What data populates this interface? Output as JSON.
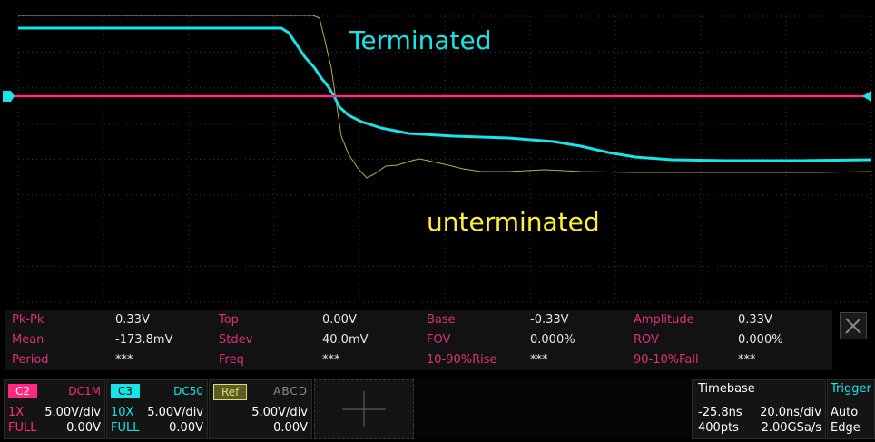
{
  "annotations": {
    "terminated": "Terminated",
    "unterminated": "unterminated"
  },
  "colors": {
    "ch2": "#ff2a7f",
    "ch3": "#17e4e8",
    "ref": "#e0e060",
    "yellow_trace": "#b8b040",
    "measure_label": "#e0307c"
  },
  "measurements": [
    [
      {
        "label": "Pk-Pk",
        "value": "0.33V"
      },
      {
        "label": "Top",
        "value": "0.00V"
      },
      {
        "label": "Base",
        "value": "-0.33V"
      },
      {
        "label": "Amplitude",
        "value": "0.33V"
      }
    ],
    [
      {
        "label": "Mean",
        "value": "-173.8mV"
      },
      {
        "label": "Stdev",
        "value": "40.0mV"
      },
      {
        "label": "FOV",
        "value": "0.000%"
      },
      {
        "label": "ROV",
        "value": "0.000%"
      }
    ],
    [
      {
        "label": "Period",
        "value": "***"
      },
      {
        "label": "Freq",
        "value": "***"
      },
      {
        "label": "10-90%Rise",
        "value": "***"
      },
      {
        "label": "90-10%Fall",
        "value": "***"
      }
    ]
  ],
  "channels": {
    "c2": {
      "tag": "C2",
      "coupling": "DC1M",
      "probe": "1X",
      "scale": "5.00V/div",
      "bw": "FULL",
      "offset": "0.00V"
    },
    "c3": {
      "tag": "C3",
      "coupling": "DC50",
      "probe": "10X",
      "scale": "5.00V/div",
      "bw": "FULL",
      "offset": "0.00V"
    },
    "ref": {
      "tag": "Ref",
      "letters": "ABCD",
      "scale": "5.00V/div",
      "offset": "0.00V"
    }
  },
  "timebase": {
    "title": "Timebase",
    "delay": "-25.8ns",
    "scale": "20.0ns/div",
    "points": "400pts",
    "rate": "2.00GSa/s"
  },
  "trigger": {
    "title": "Trigger",
    "mode": "Auto",
    "type": "Edge"
  }
}
